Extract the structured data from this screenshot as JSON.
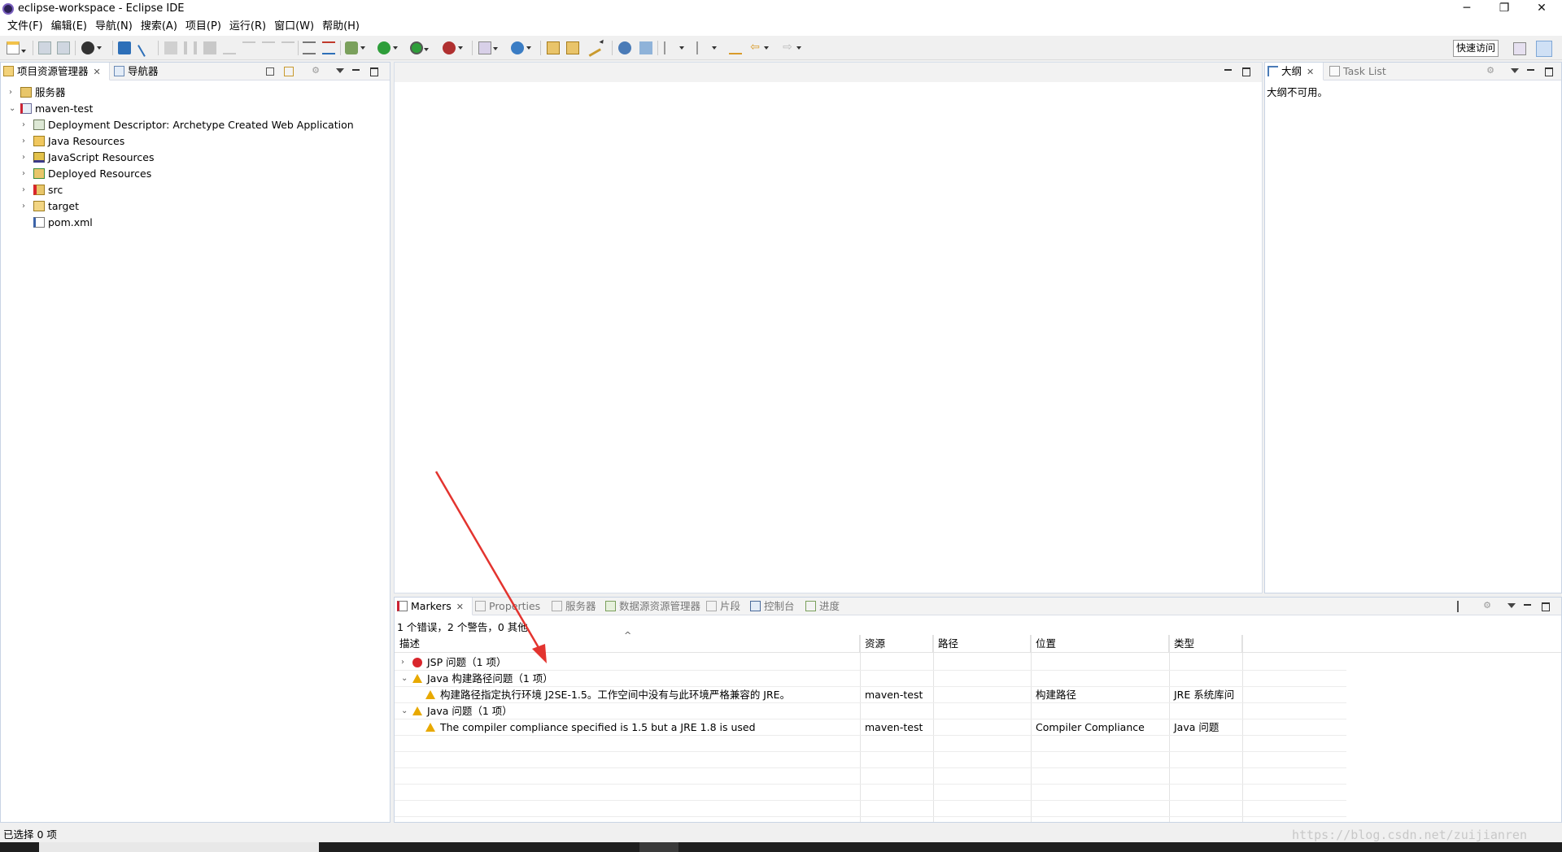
{
  "window": {
    "title": "eclipse-workspace - Eclipse IDE"
  },
  "menu": [
    "文件(F)",
    "编辑(E)",
    "导航(N)",
    "搜索(A)",
    "项目(P)",
    "运行(R)",
    "窗口(W)",
    "帮助(H)"
  ],
  "toolbar": {
    "quick_access": "快速访问"
  },
  "explorer": {
    "tabs": [
      {
        "label": "项目资源管理器"
      },
      {
        "label": "导航器"
      }
    ],
    "tree": [
      {
        "label": "服务器",
        "arrow": "›"
      },
      {
        "label": "maven-test",
        "arrow": "⌄"
      },
      {
        "label": "Deployment Descriptor: Archetype Created Web Application",
        "arrow": "›"
      },
      {
        "label": "Java Resources",
        "arrow": "›"
      },
      {
        "label": "JavaScript Resources",
        "arrow": "›"
      },
      {
        "label": "Deployed Resources",
        "arrow": "›"
      },
      {
        "label": "src",
        "arrow": "›"
      },
      {
        "label": "target",
        "arrow": "›"
      },
      {
        "label": "pom.xml",
        "arrow": ""
      }
    ]
  },
  "outline": {
    "tabs": [
      {
        "label": "大纲"
      },
      {
        "label": "Task List"
      }
    ],
    "message": "大纲不可用。"
  },
  "bottom": {
    "tabs": [
      {
        "label": "Markers"
      },
      {
        "label": "Properties"
      },
      {
        "label": "服务器"
      },
      {
        "label": "数据源资源管理器"
      },
      {
        "label": "片段"
      },
      {
        "label": "控制台"
      },
      {
        "label": "进度"
      }
    ],
    "summary": "1 个错误，2 个警告，0 其他",
    "sort_indicator": "^",
    "columns": [
      "描述",
      "资源",
      "路径",
      "位置",
      "类型"
    ],
    "rows": [
      {
        "desc": "JSP 问题（1 项）",
        "arrow": "›",
        "resource": "",
        "path": "",
        "location": "",
        "type": ""
      },
      {
        "desc": "Java 构建路径问题（1 项）",
        "arrow": "⌄",
        "resource": "",
        "path": "",
        "location": "",
        "type": ""
      },
      {
        "desc": "构建路径指定执行环境 J2SE-1.5。工作空间中没有与此环境严格兼容的 JRE。",
        "arrow": "",
        "resource": "maven-test",
        "path": "",
        "location": "构建路径",
        "type": "JRE 系统库问"
      },
      {
        "desc": "Java 问题（1 项）",
        "arrow": "⌄",
        "resource": "",
        "path": "",
        "location": "",
        "type": ""
      },
      {
        "desc": "The compiler compliance specified is 1.5 but a JRE 1.8 is used",
        "arrow": "",
        "resource": "maven-test",
        "path": "",
        "location": "Compiler Compliance",
        "type": "Java 问题"
      }
    ]
  },
  "status": {
    "text": "已选择 0 项"
  },
  "watermark": "https://blog.csdn.net/zuijianren",
  "colors": {
    "error": "#d9262c",
    "warning": "#e8a900",
    "annotation": "#e3342f",
    "selection": "#d8e6f8"
  }
}
